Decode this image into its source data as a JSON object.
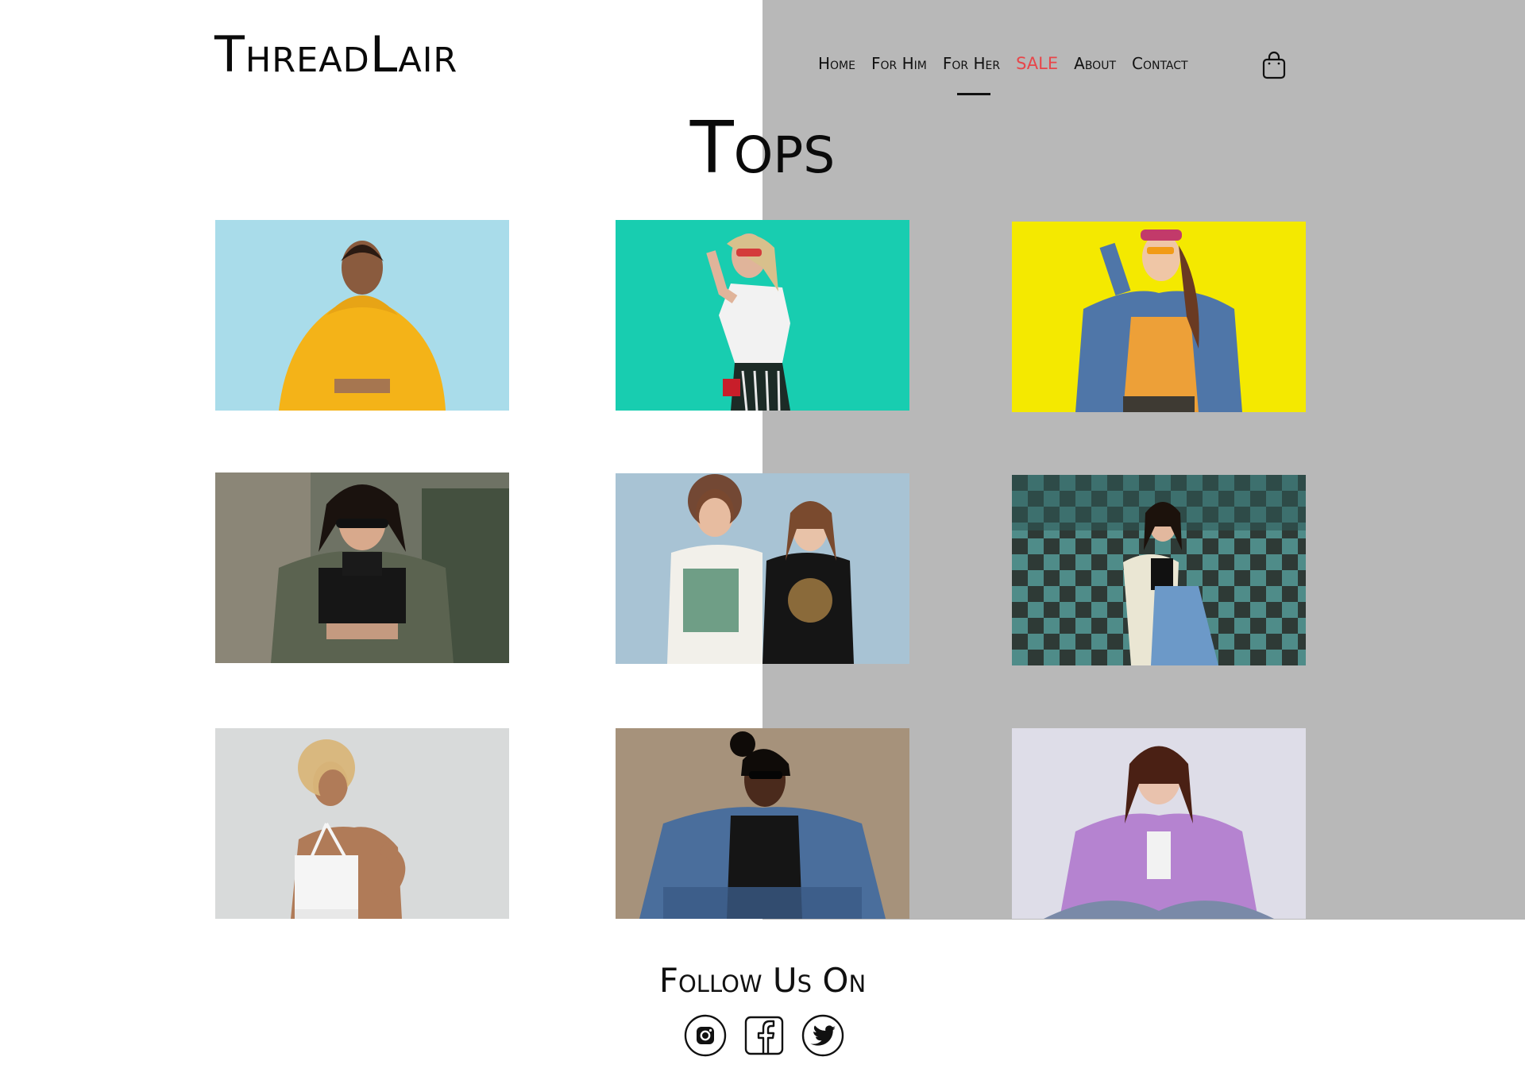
{
  "brand": {
    "logo": "ThreadLair"
  },
  "nav": {
    "items": [
      {
        "label": "Home"
      },
      {
        "label": "For Him"
      },
      {
        "label": "For Her"
      },
      {
        "label": "SALE"
      },
      {
        "label": "About"
      },
      {
        "label": "Contact"
      }
    ],
    "active": "For Her",
    "sale_color": "#e8464a"
  },
  "cart_icon": "shopping-bag-icon",
  "page_title": "Tops",
  "products": [
    {
      "name": "yellow-hoodie-photo",
      "bg": "#a9dcea"
    },
    {
      "name": "white-tank-photo",
      "bg": "#18cdb0"
    },
    {
      "name": "denim-jacket-photo",
      "bg": "#f4e900"
    },
    {
      "name": "black-crop-top-photo",
      "bg": "#6e7264"
    },
    {
      "name": "graphic-tees-photo",
      "bg": "#a8c3d4"
    },
    {
      "name": "checkered-wall-photo",
      "bg": "#3d6f6c"
    },
    {
      "name": "white-halter-photo",
      "bg": "#d8dada"
    },
    {
      "name": "black-tank-denim-photo",
      "bg": "#a6927b"
    },
    {
      "name": "purple-shirt-photo",
      "bg": "#dedde8"
    }
  ],
  "footer": {
    "follow_label": "Follow Us On",
    "socials": [
      {
        "icon": "instagram-icon"
      },
      {
        "icon": "facebook-icon"
      },
      {
        "icon": "twitter-icon"
      }
    ]
  }
}
